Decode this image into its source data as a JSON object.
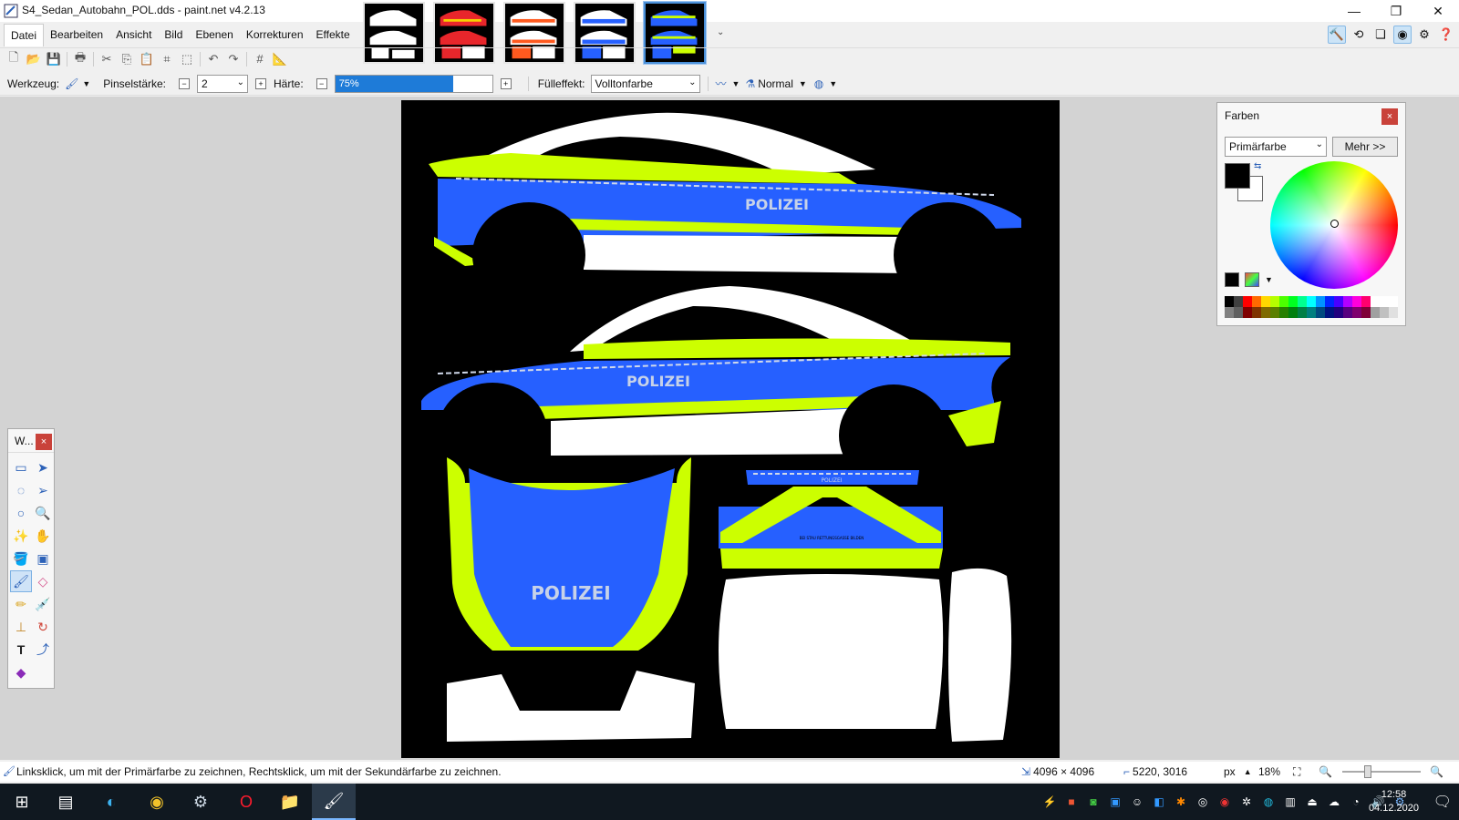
{
  "window": {
    "title": "S4_Sedan_Autobahn_POL.dds - paint.net v4.2.13",
    "minimize": "—",
    "restore": "❐",
    "close": "✕"
  },
  "menu": [
    "Datei",
    "Bearbeiten",
    "Ansicht",
    "Bild",
    "Ebenen",
    "Korrekturen",
    "Effekte"
  ],
  "toolbar2": {
    "tool_label": "Werkzeug:",
    "brush_size_label": "Pinselstärke:",
    "brush_size_value": "2",
    "hardness_label": "Härte:",
    "hardness_value": "75%",
    "hardness_fraction": 0.75,
    "fill_label": "Fülleffekt:",
    "fill_value": "Volltonfarbe",
    "blend_mode": "Normal"
  },
  "canvas": {
    "text_top": "POLIZEI",
    "text_mid": "POLIZEI",
    "text_hood": "POLIZEI",
    "text_trunk": "POLIZEI",
    "text_trunk_small": "BEI STAU RETTUNGSGASSE BILDEN",
    "colors": {
      "blue": "#2660ff",
      "yellow": "#ccff00",
      "white": "#ffffff",
      "black": "#000000"
    }
  },
  "tools_window": {
    "title": "W..."
  },
  "colors_window": {
    "title": "Farben",
    "selector_value": "Primärfarbe",
    "more_button": "Mehr >>",
    "primary_color": "#000000",
    "secondary_color": "#ffffff",
    "palette_top": [
      "#000000",
      "#404040",
      "#ff0000",
      "#ff6a00",
      "#ffd800",
      "#b6ff00",
      "#4cff00",
      "#00ff21",
      "#00ff90",
      "#00ffff",
      "#0094ff",
      "#0026ff",
      "#4800ff",
      "#b200ff",
      "#ff00dc",
      "#ff006e",
      "#ffffff",
      "#ffffff",
      "#ffffff"
    ],
    "palette_bottom": [
      "#808080",
      "#606060",
      "#7f0000",
      "#7f3300",
      "#7f6a00",
      "#5b7f00",
      "#267f00",
      "#007f0e",
      "#007f46",
      "#007f7f",
      "#004a7f",
      "#00137f",
      "#21007f",
      "#57007f",
      "#7f006e",
      "#7f0037",
      "#a0a0a0",
      "#c0c0c0",
      "#e0e0e0"
    ]
  },
  "status": {
    "hint": "Linksklick, um mit der Primärfarbe zu zeichnen, Rechtsklick, um mit der Sekundärfarbe zu zeichnen.",
    "image_size": "4096 × 4096",
    "cursor_pos": "5220, 3016",
    "unit": "px",
    "zoom": "18%"
  },
  "taskbar": {
    "time": "12:58",
    "date": "04.12.2020"
  }
}
